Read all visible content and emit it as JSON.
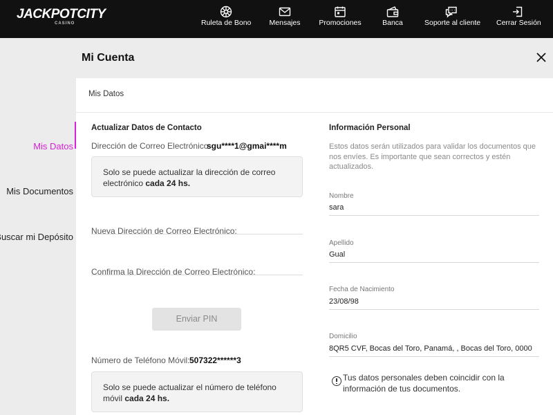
{
  "brand": {
    "logo_main": "JACKPOTCITY",
    "logo_sub": "CASINO",
    "accent_color": "#d61fd6"
  },
  "topnav": [
    {
      "label": "Ruleta de Bono",
      "icon": "roulette-wheel-icon"
    },
    {
      "label": "Mensajes",
      "icon": "envelope-icon"
    },
    {
      "label": "Promociones",
      "icon": "calendar-icon"
    },
    {
      "label": "Banca",
      "icon": "wallet-cards-icon"
    },
    {
      "label": "Soporte al cliente",
      "icon": "chat-bubbles-icon"
    },
    {
      "label": "Cerrar Sesión",
      "icon": "logout-icon"
    }
  ],
  "sidebar": {
    "items": [
      {
        "label": "Mis Datos",
        "active": true
      },
      {
        "label": "Mis Documentos",
        "active": false
      },
      {
        "label": "Buscar mi Depósito",
        "active": false
      }
    ]
  },
  "header": {
    "title": "Mi Cuenta",
    "close_icon": "close-icon"
  },
  "breadcrumb": "Mis Datos",
  "contact": {
    "title": "Actualizar Datos de Contacto",
    "email_label": "Dirección de Correo Electrónico:",
    "email_value": "sgu****1@gmai****m",
    "email_notice_text": "Solo se puede actualizar la dirección de correo electrónico ",
    "email_notice_bold": "cada 24 hs.",
    "new_email_placeholder": "Nueva Dirección de Correo Electrónico:",
    "confirm_email_placeholder": "Confirma la Dirección de Correo Electrónico:",
    "send_pin_label": "Enviar PIN",
    "phone_label": "Número de Teléfono Móvil:",
    "phone_value": "507322******3",
    "phone_notice_text": "Solo se puede actualizar el número de teléfono móvil ",
    "phone_notice_bold": "cada 24 hs."
  },
  "personal": {
    "title": "Información Personal",
    "description": "Estos datos serán utilizados para validar los documentos que nos envíes. Es importante que sean correctos y estén actualizados.",
    "fields": [
      {
        "label": "Nombre",
        "value": "sara"
      },
      {
        "label": "Apellido",
        "value": "Gual"
      },
      {
        "label": "Fecha de Nacimiento",
        "value": "23/08/98"
      },
      {
        "label": "Domicilio",
        "value": "8QR5 CVF, Bocas del Toro, Panamá, , Bocas del Toro, 0000"
      }
    ],
    "warning": "Tus datos personales deben coincidir con la información de tus documentos."
  }
}
